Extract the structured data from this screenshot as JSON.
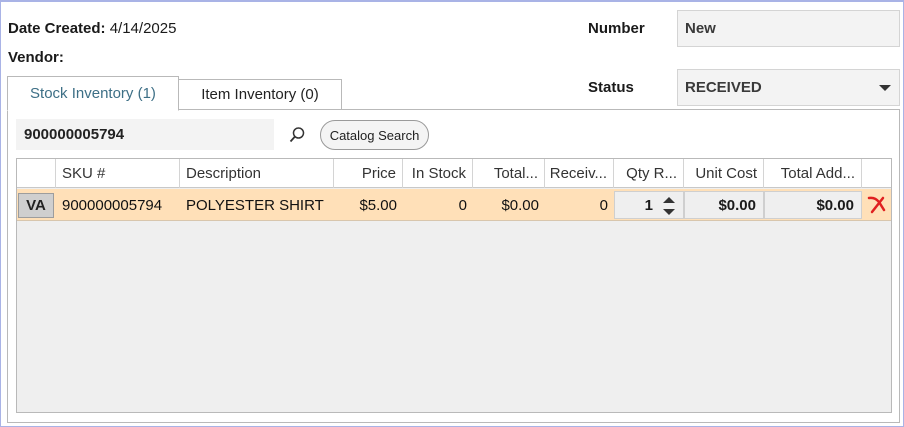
{
  "header": {
    "date_created_label": "Date Created:",
    "date_created_value": "4/14/2025",
    "vendor_label": "Vendor:",
    "number_label": "Number",
    "number_value": "New",
    "status_label": "Status",
    "status_value": "RECEIVED"
  },
  "tabs": [
    {
      "label": "Stock Inventory (1)",
      "active": true
    },
    {
      "label": "Item Inventory (0)",
      "active": false
    }
  ],
  "search": {
    "value": "900000005794",
    "catalog_button": "Catalog Search"
  },
  "grid": {
    "columns": [
      "SKU #",
      "Description",
      "Price",
      "In Stock",
      "Total...",
      "Receiv...",
      "Qty R...",
      "Unit Cost",
      "Total Add..."
    ],
    "rows": [
      {
        "row_header": "VA",
        "sku": "900000005794",
        "description": "POLYESTER SHIRT",
        "price": "$5.00",
        "in_stock": "0",
        "total": "$0.00",
        "received": "0",
        "qty": "1",
        "unit_cost": "$0.00",
        "total_add": "$0.00"
      }
    ]
  },
  "colors": {
    "selected_row": "#ffe0b8",
    "active_tab_text": "#3d6f86",
    "delete_icon": "#e02020",
    "frame_border": "#a9b3e6"
  }
}
